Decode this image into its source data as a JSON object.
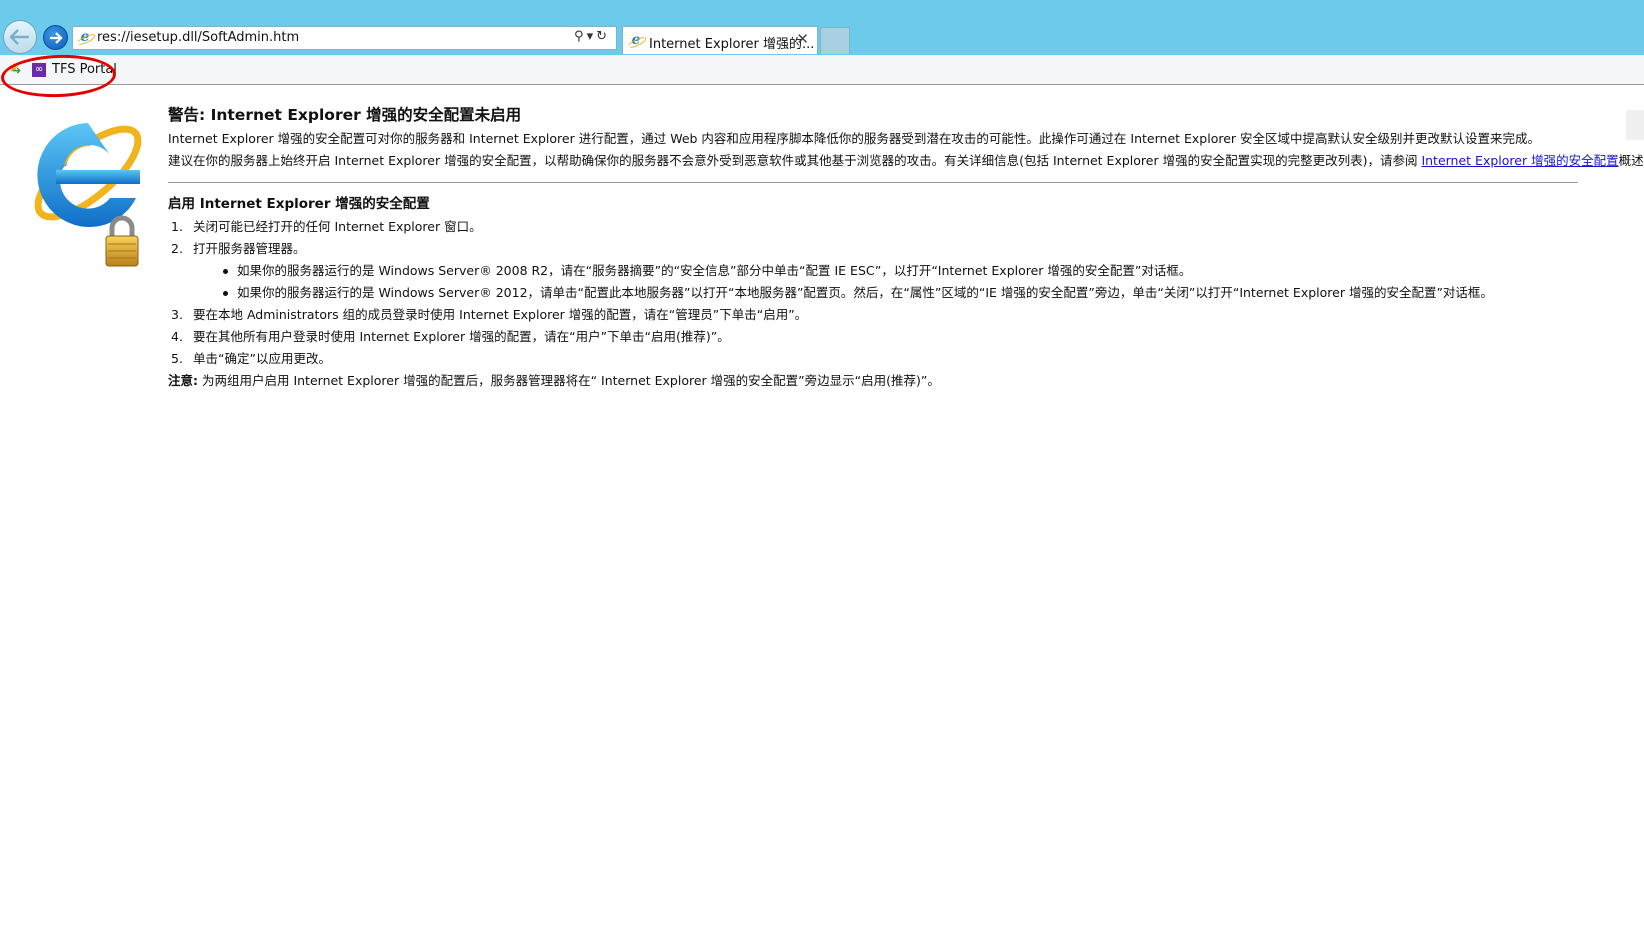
{
  "browser": {
    "address": "res://iesetup.dll/SoftAdmin.htm",
    "tab_title": "Internet Explorer 增强的...",
    "tab_close": "✕",
    "favorites": [
      {
        "label": "TFS Portal",
        "icon": "visual-studio-icon"
      }
    ]
  },
  "page": {
    "warning_title": "警告: Internet Explorer 增强的安全配置未启用",
    "intro_para": "Internet Explorer 增强的安全配置可对你的服务器和 Internet Explorer 进行配置，通过 Web 内容和应用程序脚本降低你的服务器受到潜在攻击的可能性。此操作可通过在 Internet Explorer 安全区域中提高默认安全级别并更改默认设置来完成。",
    "recommend_para": "建议在你的服务器上始终开启 Internet Explorer 增强的安全配置，以帮助确保你的服务器不会意外受到恶意软件或其他基于浏览器的攻击。有关详细信息(包括 Internet Explorer 增强的安全配置实现的完整更改列表)，请参阅 ",
    "recommend_link": "Internet Explorer 增强的安全配置",
    "recommend_tail": "概述。",
    "section_title": "启用 Internet Explorer 增强的安全配置",
    "steps": [
      {
        "num": "1.",
        "text": "关闭可能已经打开的任何 Internet Explorer 窗口。"
      },
      {
        "num": "2.",
        "text": "打开服务器管理器。"
      },
      {
        "num": "3.",
        "text": "要在本地 Administrators 组的成员登录时使用 Internet Explorer 增强的配置，请在“管理员”下单击“启用”。"
      },
      {
        "num": "4.",
        "text": "要在其他所有用户登录时使用 Internet Explorer 增强的配置，请在“用户”下单击“启用(推荐)”。"
      },
      {
        "num": "5.",
        "text": "单击“确定”以应用更改。"
      }
    ],
    "substeps": [
      "如果你的服务器运行的是 Windows Server® 2008 R2，请在“服务器摘要”的“安全信息”部分中单击“配置 IE ESC”，以打开“Internet Explorer 增强的安全配置”对话框。",
      "如果你的服务器运行的是 Windows Server® 2012，请单击“配置此本地服务器”以打开“本地服务器”配置页。然后，在“属性”区域的“IE 增强的安全配置”旁边，单击“关闭”以打开“Internet Explorer 增强的安全配置”对话框。"
    ],
    "note_label": "注意:",
    "note_text": " 为两组用户启用 Internet Explorer 增强的配置后，服务器管理器将在“ Internet Explorer 增强的安全配置”旁边显示“启用(推荐)”。"
  },
  "colors": {
    "chrome": "#6ccbea",
    "link": "#1515cc",
    "annotation": "#e40000"
  }
}
